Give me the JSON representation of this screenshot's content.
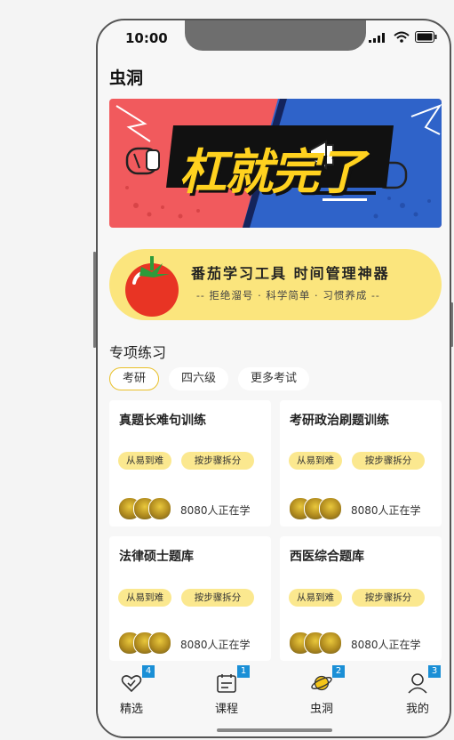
{
  "status_bar": {
    "time": "10:00"
  },
  "page": {
    "title": "虫洞"
  },
  "banner_main": {
    "text": "杠就完了"
  },
  "banner_tomato": {
    "title": "番茄学习工具 时间管理神器",
    "subtitle": "-- 拒绝溜号 · 科学简单 · 习惯养成 --"
  },
  "section": {
    "title": "专项练习"
  },
  "chips": [
    {
      "label": "考研",
      "active": true
    },
    {
      "label": "四六级",
      "active": false
    },
    {
      "label": "更多考试",
      "active": false
    }
  ],
  "cards": [
    {
      "title": "真题长难句训练",
      "tags": [
        "从易到难",
        "按步骤拆分"
      ],
      "learners": "8080人正在学"
    },
    {
      "title": "考研政治刷题训练",
      "tags": [
        "从易到难",
        "按步骤拆分"
      ],
      "learners": "8080人正在学"
    },
    {
      "title": "法律硕士题库",
      "tags": [
        "从易到难",
        "按步骤拆分"
      ],
      "learners": "8080人正在学"
    },
    {
      "title": "西医综合题库",
      "tags": [
        "从易到难",
        "按步骤拆分"
      ],
      "learners": "8080人正在学"
    }
  ],
  "tabs": [
    {
      "label": "精选",
      "badge": "4",
      "icon": "heart-check-icon"
    },
    {
      "label": "课程",
      "badge": "1",
      "icon": "calendar-list-icon"
    },
    {
      "label": "虫洞",
      "badge": "2",
      "icon": "planet-icon"
    },
    {
      "label": "我的",
      "badge": "3",
      "icon": "user-icon"
    }
  ],
  "colors": {
    "accent_yellow": "#fbe57d",
    "tag_yellow": "#fbe88f",
    "badge_blue": "#1a8fd6",
    "banner_red": "#f15a5d",
    "banner_blue": "#2f63c9"
  }
}
